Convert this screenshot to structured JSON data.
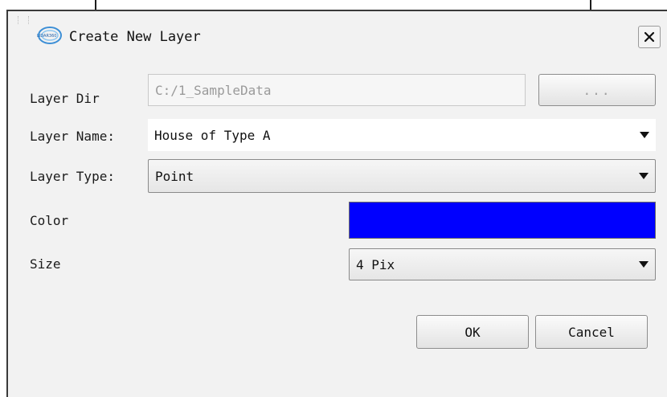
{
  "dialog": {
    "title": "Create New Layer",
    "logo_text": "LIDAR360"
  },
  "form": {
    "layer_dir": {
      "label": "Layer Dir",
      "value": "C:/1_SampleData",
      "browse_label": "..."
    },
    "layer_name": {
      "label": "Layer Name:",
      "value": "House of Type A"
    },
    "layer_type": {
      "label": "Layer Type:",
      "value": "Point"
    },
    "color": {
      "label": "Color",
      "value": "#0000ff"
    },
    "size": {
      "label": "Size",
      "value": "4 Pix"
    }
  },
  "buttons": {
    "ok": "OK",
    "cancel": "Cancel"
  },
  "icons": {
    "close": "close-icon",
    "dropdown": "chevron-down-icon",
    "logo": "app-logo-icon"
  }
}
